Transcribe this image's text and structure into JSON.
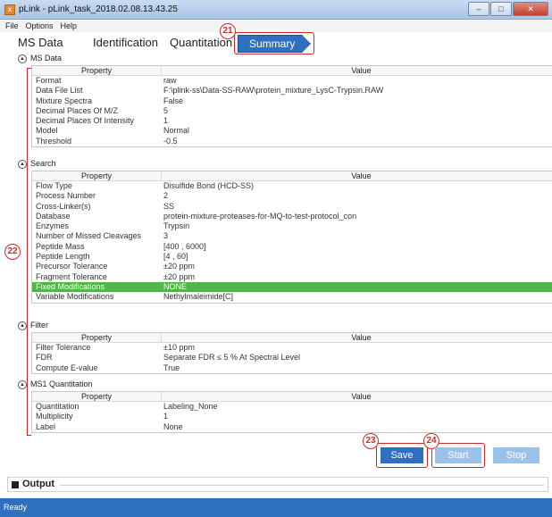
{
  "window": {
    "title": "pLink - pLink_task_2018.02.08.13.43.25",
    "app_icon": "x",
    "controls": {
      "minimize": "–",
      "maximize": "□",
      "close": "✕"
    }
  },
  "menu": [
    "File",
    "Options",
    "Help"
  ],
  "tabs": [
    {
      "label": "MS Data",
      "active": false
    },
    {
      "label": "Identification",
      "active": false
    },
    {
      "label": "Quantitation",
      "active": false
    },
    {
      "label": "Summary",
      "active": true
    }
  ],
  "callouts": [
    "21",
    "22",
    "23",
    "24"
  ],
  "table_headers": {
    "property": "Property",
    "value": "Value"
  },
  "sections": [
    {
      "title": "MS Data",
      "rows": [
        [
          "Format",
          "raw"
        ],
        [
          "Data File List",
          "F:\\plink-ss\\Data-SS-RAW\\protein_mixture_LysC-Trypsin.RAW"
        ],
        [
          "Mixture Spectra",
          "False"
        ],
        [
          "Decimal Places Of M/Z",
          "5"
        ],
        [
          "Decimal Places Of Intensity",
          "1"
        ],
        [
          "Model",
          "Normal"
        ],
        [
          "Threshold",
          "-0.5"
        ]
      ]
    },
    {
      "title": "Search",
      "rows": [
        [
          "Flow Type",
          "Disulfide Bond (HCD-SS)"
        ],
        [
          "Process Number",
          "2"
        ],
        [
          "Cross-Linker(s)",
          "SS"
        ],
        [
          "Database",
          "protein-mixture-proteases-for-MQ-to-test-protocol_con"
        ],
        [
          "Enzymes",
          "Trypsin"
        ],
        [
          "Number of Missed Cleavages",
          "3"
        ],
        [
          "Peptide Mass",
          "[400 , 6000]"
        ],
        [
          "Peptide Length",
          "[4 , 60]"
        ],
        [
          "Precursor Tolerance",
          "±20 ppm"
        ],
        [
          "Fragment Tolerance",
          "±20 ppm"
        ],
        [
          "Fixed Modifications",
          "NONE"
        ],
        [
          "Variable Modifications",
          "Nethylmaleimide[C]"
        ]
      ]
    },
    {
      "title": "Filter",
      "rows": [
        [
          "Filter Tolerance",
          "±10 ppm"
        ],
        [
          "FDR",
          "Separate FDR ≤ 5 % At Spectral Level"
        ],
        [
          "Compute E-value",
          "True"
        ]
      ]
    },
    {
      "title": "MS1 Quantitation",
      "rows": [
        [
          "Quantitation",
          "Labeling_None"
        ],
        [
          "Multiplicity",
          "1"
        ],
        [
          "Label",
          "None"
        ]
      ]
    }
  ],
  "buttons": {
    "save": "Save",
    "start": "Start",
    "stop": "Stop"
  },
  "output": {
    "label": "Output"
  },
  "status": "Ready",
  "colors": {
    "accent": "#2f6fbf",
    "highlight_row": "#52b54a",
    "callout": "#cc2a2a",
    "disabled_button": "#9cc2ec"
  }
}
